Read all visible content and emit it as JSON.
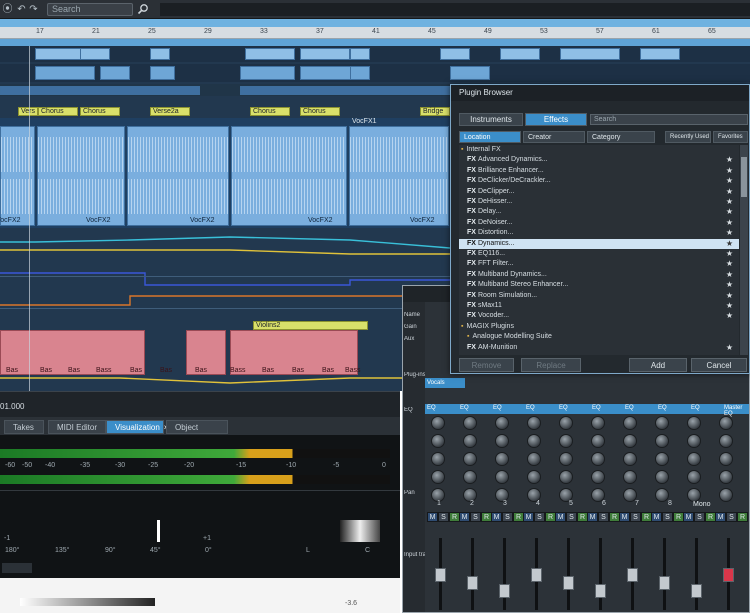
{
  "toolbar": {
    "search_placeholder": "Search"
  },
  "ruler_top": [
    "17",
    "21",
    "25",
    "29",
    "33",
    "37",
    "41",
    "45",
    "49",
    "53",
    "57",
    "61",
    "65"
  ],
  "markers": [
    "Vers",
    "Chorus",
    "Chorus",
    "Verse2a",
    "Chorus",
    "Chorus",
    "Bridge"
  ],
  "vocal_labels": [
    "VocFX1"
  ],
  "voc_clips": [
    "VocFX2",
    "VocFX2",
    "VocFX2",
    "VocFX2",
    "VocFX2"
  ],
  "bass_clips": [
    "Bas",
    "Bas",
    "Bas",
    "Bass",
    "Bas",
    "Bas",
    "Bas",
    "Bass",
    "Bas",
    "Bas",
    "Bas",
    "Bass"
  ],
  "violins_label": "Violins2",
  "timebar": {
    "position": "01.000"
  },
  "tabs": [
    "Takes",
    "MIDI Editor",
    "Visualization",
    "Object Editor"
  ],
  "tab_close": "×",
  "meter_scale": [
    "-60",
    "-50",
    "-40",
    "-35",
    "-30",
    "-25",
    "-20",
    "-15",
    "-10",
    "-5",
    "0"
  ],
  "phase_scale": [
    "180°",
    "135°",
    "90°",
    "45°",
    "0°"
  ],
  "phase_side": [
    "-1",
    "+1"
  ],
  "lr_labels": [
    "L",
    "C"
  ],
  "bottom_readout": "-3.6",
  "plugin_browser": {
    "title": "Plugin Browser",
    "tabs": [
      "Instruments",
      "Effects"
    ],
    "active_tab": "Effects",
    "search_placeholder": "Search",
    "columns": [
      "Location",
      "Creator",
      "Category"
    ],
    "right_cols": [
      "Recently Used",
      "Favorites"
    ],
    "items": [
      {
        "kind": "folder",
        "label": "Internal FX"
      },
      {
        "kind": "fx",
        "label": "Advanced Dynamics..."
      },
      {
        "kind": "fx",
        "label": "Brilliance Enhancer..."
      },
      {
        "kind": "fx",
        "label": "DeClicker/DeCrackler..."
      },
      {
        "kind": "fx",
        "label": "DeClipper..."
      },
      {
        "kind": "fx",
        "label": "DeHisser..."
      },
      {
        "kind": "fx",
        "label": "Delay..."
      },
      {
        "kind": "fx",
        "label": "DeNoiser..."
      },
      {
        "kind": "fx",
        "label": "Distortion..."
      },
      {
        "kind": "fx-selected",
        "label": "Dynamics..."
      },
      {
        "kind": "fx",
        "label": "EQ116..."
      },
      {
        "kind": "fx",
        "label": "FFT Filter..."
      },
      {
        "kind": "fx",
        "label": "Multiband Dynamics..."
      },
      {
        "kind": "fx",
        "label": "Multiband Stereo Enhancer..."
      },
      {
        "kind": "fx",
        "label": "Room Simulation..."
      },
      {
        "kind": "fx",
        "label": "sMax11"
      },
      {
        "kind": "fx",
        "label": "Vocoder..."
      },
      {
        "kind": "folder",
        "label": "MAGIX Plugins"
      },
      {
        "kind": "folder2",
        "label": "Analogue Modelling Suite"
      },
      {
        "kind": "fx",
        "label": "AM-Munition"
      }
    ],
    "fx_prefix": "FX",
    "star": "★",
    "buttons": [
      "Remove",
      "Replace",
      "Add",
      "Cancel"
    ]
  },
  "mixer": {
    "labels": [
      "Name",
      "Gain",
      "Aux",
      "Plug-ins",
      "EQ",
      "Pan",
      "Input track"
    ],
    "channel_buttons": [
      "M",
      "S",
      "R"
    ],
    "eq_labels": [
      "EQ",
      "EQ",
      "EQ",
      "EQ",
      "EQ",
      "EQ",
      "EQ",
      "EQ",
      "EQ",
      "Master EQ"
    ],
    "channel_numbers": [
      "1",
      "2",
      "3",
      "4",
      "5",
      "6",
      "7",
      "8"
    ],
    "mono_label": "Mono",
    "plugin_slot": "Vocals"
  },
  "colors": {
    "arranger_bg": "#22384f",
    "audio_object": "#7aaede",
    "bass_object": "#d9848f",
    "accent": "#3b8ec9",
    "marker": "#d9e06a"
  }
}
